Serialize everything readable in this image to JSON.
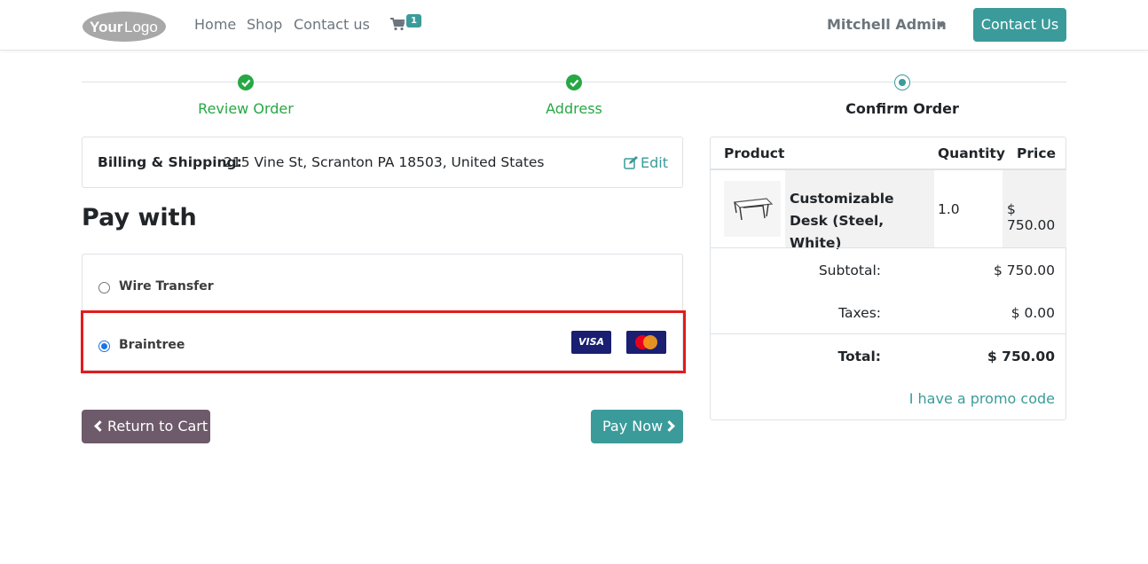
{
  "nav": {
    "logo_text": "YourLogo",
    "links": [
      "Home",
      "Shop",
      "Contact us"
    ],
    "cart_count": "1",
    "user_name": "Mitchell Admin",
    "contact_button": "Contact Us"
  },
  "steps": [
    {
      "label": "Review Order",
      "state": "done"
    },
    {
      "label": "Address",
      "state": "done"
    },
    {
      "label": "Confirm Order",
      "state": "current"
    }
  ],
  "billing": {
    "label": "Billing & Shipping:",
    "address": "215 Vine St, Scranton PA 18503, United States",
    "edit_label": "Edit"
  },
  "payment": {
    "title": "Pay with",
    "methods": [
      {
        "label": "Wire Transfer",
        "selected": false
      },
      {
        "label": "Braintree",
        "selected": true,
        "cards": [
          "VISA",
          "MasterCard"
        ]
      }
    ],
    "highlight_color": "#e31b1b"
  },
  "actions": {
    "return_label": "Return to Cart",
    "pay_label": "Pay Now"
  },
  "summary": {
    "headers": {
      "product": "Product",
      "quantity": "Quantity",
      "price": "Price"
    },
    "item": {
      "name": "Customizable Desk (Steel, White)",
      "quantity": "1.0",
      "price": "$ 750.00"
    },
    "subtotal_label": "Subtotal:",
    "subtotal_value": "$ 750.00",
    "taxes_label": "Taxes:",
    "taxes_value": "$ 0.00",
    "total_label": "Total:",
    "total_value": "$ 750.00",
    "promo_label": "I have a promo code"
  },
  "colors": {
    "primary": "#3a9b9a",
    "success": "#28a745",
    "secondary_button": "#6d5a6a",
    "corner": "#6d4f68"
  }
}
